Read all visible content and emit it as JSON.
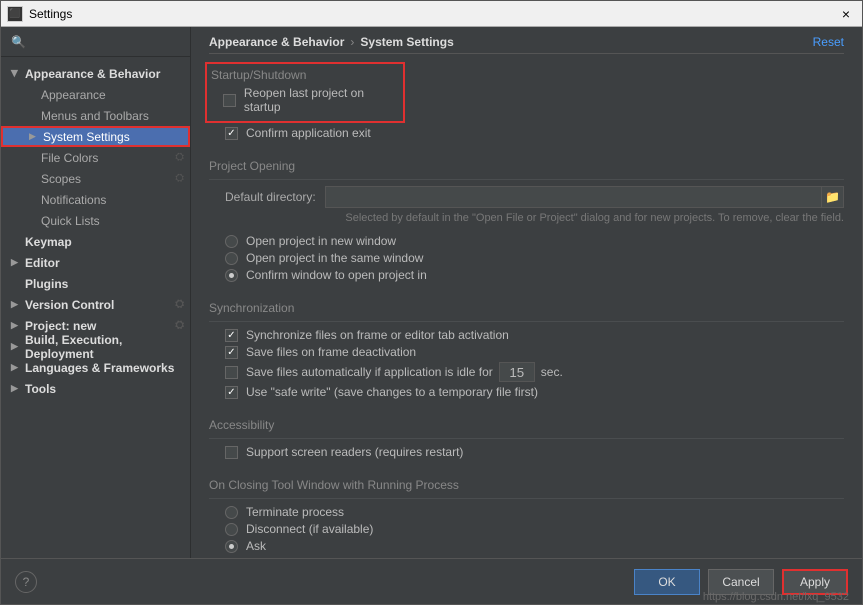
{
  "titlebar": {
    "title": "Settings",
    "close": "×"
  },
  "sidebar": {
    "search_placeholder": "",
    "items": [
      {
        "label": "Appearance & Behavior",
        "kind": "top",
        "expanded": true
      },
      {
        "label": "Appearance",
        "kind": "child"
      },
      {
        "label": "Menus and Toolbars",
        "kind": "child"
      },
      {
        "label": "System Settings",
        "kind": "child",
        "selected": true,
        "caret": true
      },
      {
        "label": "File Colors",
        "kind": "child",
        "cfg": true
      },
      {
        "label": "Scopes",
        "kind": "child",
        "cfg": true
      },
      {
        "label": "Notifications",
        "kind": "child"
      },
      {
        "label": "Quick Lists",
        "kind": "child"
      },
      {
        "label": "Keymap",
        "kind": "top"
      },
      {
        "label": "Editor",
        "kind": "top",
        "caret": true
      },
      {
        "label": "Plugins",
        "kind": "top"
      },
      {
        "label": "Version Control",
        "kind": "top",
        "caret": true,
        "cfg": true
      },
      {
        "label": "Project: new",
        "kind": "top",
        "caret": true,
        "cfg": true
      },
      {
        "label": "Build, Execution, Deployment",
        "kind": "top",
        "caret": true
      },
      {
        "label": "Languages & Frameworks",
        "kind": "top",
        "caret": true
      },
      {
        "label": "Tools",
        "kind": "top",
        "caret": true
      }
    ]
  },
  "breadcrumb": {
    "a": "Appearance & Behavior",
    "b": "System Settings",
    "reset": "Reset"
  },
  "sections": {
    "startup": {
      "title": "Startup/Shutdown",
      "reopen": "Reopen last project on startup",
      "confirm_exit": "Confirm application exit"
    },
    "opening": {
      "title": "Project Opening",
      "default_dir_label": "Default directory:",
      "hint": "Selected by default in the \"Open File or Project\" dialog and for new projects. To remove, clear the field.",
      "opt_new": "Open project in new window",
      "opt_same": "Open project in the same window",
      "opt_confirm": "Confirm window to open project in"
    },
    "sync": {
      "title": "Synchronization",
      "sync_frame": "Synchronize files on frame or editor tab activation",
      "save_frame": "Save files on frame deactivation",
      "save_idle_a": "Save files automatically if application is idle for",
      "save_idle_value": "15",
      "save_idle_b": "sec.",
      "safe_write": "Use \"safe write\" (save changes to a temporary file first)"
    },
    "a11y": {
      "title": "Accessibility",
      "screen_readers": "Support screen readers (requires restart)"
    },
    "closing": {
      "title": "On Closing Tool Window with Running Process",
      "terminate": "Terminate process",
      "disconnect": "Disconnect (if available)",
      "ask": "Ask"
    }
  },
  "footer": {
    "ok": "OK",
    "cancel": "Cancel",
    "apply": "Apply",
    "help": "?"
  },
  "watermark": "https://blog.csdn.net/lxq_9532"
}
